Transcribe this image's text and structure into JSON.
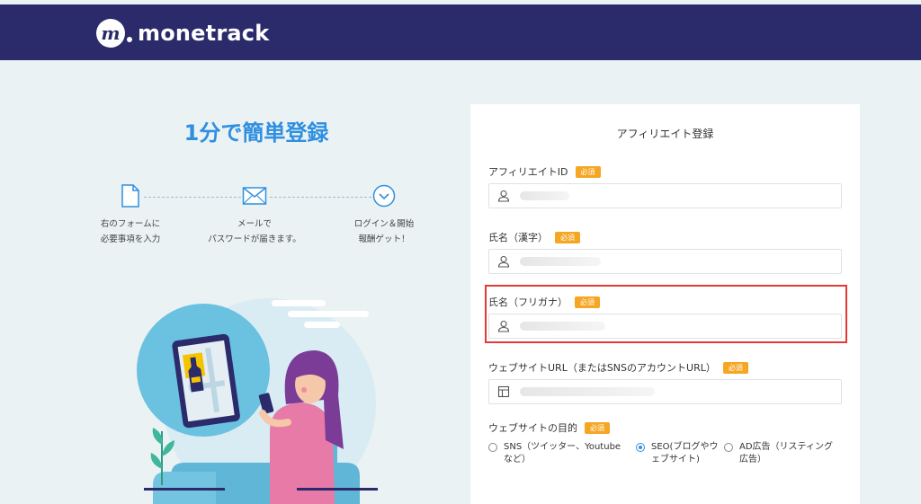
{
  "header": {
    "brand": "monetrack"
  },
  "hero": {
    "title": "1分で簡単登録",
    "steps": [
      {
        "icon": "document-icon",
        "line1": "右のフォームに",
        "line2": "必要事項を入力"
      },
      {
        "icon": "mail-icon",
        "line1": "メールで",
        "line2": "パスワードが届きます。"
      },
      {
        "icon": "chevron-down-circle-icon",
        "line1": "ログイン＆開始",
        "line2": "報酬ゲット！"
      }
    ]
  },
  "form": {
    "title": "アフィリエイト登録",
    "required_badge": "必須",
    "fields": [
      {
        "label": "アフィリエイトID",
        "icon": "user-icon"
      },
      {
        "label": "氏名（漢字）",
        "icon": "user-icon"
      },
      {
        "label": "氏名（フリガナ）",
        "icon": "user-icon"
      },
      {
        "label": "ウェブサイトURL（またはSNSのアカウントURL）",
        "icon": "window-icon"
      }
    ],
    "purpose": {
      "label": "ウェブサイトの目的",
      "options": [
        {
          "line1": "SNS（ツイッター、Youtube",
          "line2": "など）",
          "selected": false
        },
        {
          "line1": "SEO(ブログやウ",
          "line2": "ェブサイト)",
          "selected": true
        },
        {
          "line1": "AD広告（リスティング",
          "line2": "広告）",
          "selected": false
        }
      ]
    }
  },
  "colors": {
    "header_bg": "#2b2a6b",
    "accent": "#2f8fe0",
    "badge": "#f5a623",
    "highlight": "#e53935"
  }
}
